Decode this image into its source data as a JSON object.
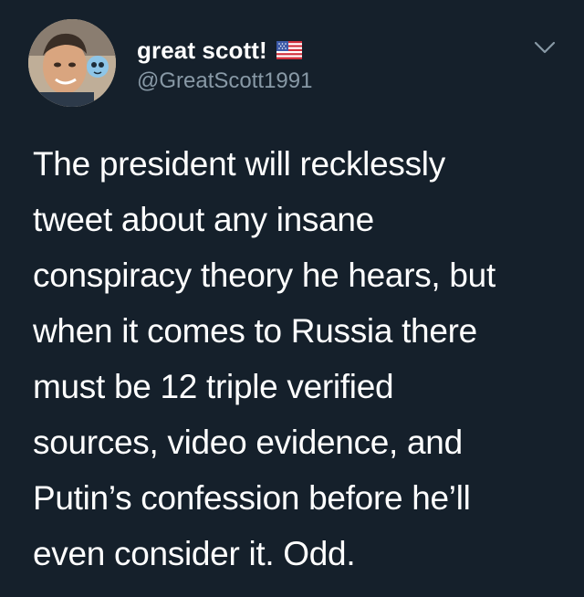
{
  "author": {
    "display_name": "great scott!",
    "handle": "@GreatScott1991",
    "badge_icon": "us-flag-icon"
  },
  "menu": {
    "icon": "chevron-down-icon"
  },
  "tweet": {
    "lines": [
      "The president will recklessly",
      "tweet about any insane",
      "conspiracy theory he hears, but",
      "when it comes to Russia there",
      "must be 12 triple verified",
      "sources, video evidence, and",
      "Putin’s confession before he’ll",
      "even consider it. Odd."
    ]
  },
  "colors": {
    "background": "#15202b",
    "text": "#ffffff",
    "secondary_text": "#8899a6"
  }
}
